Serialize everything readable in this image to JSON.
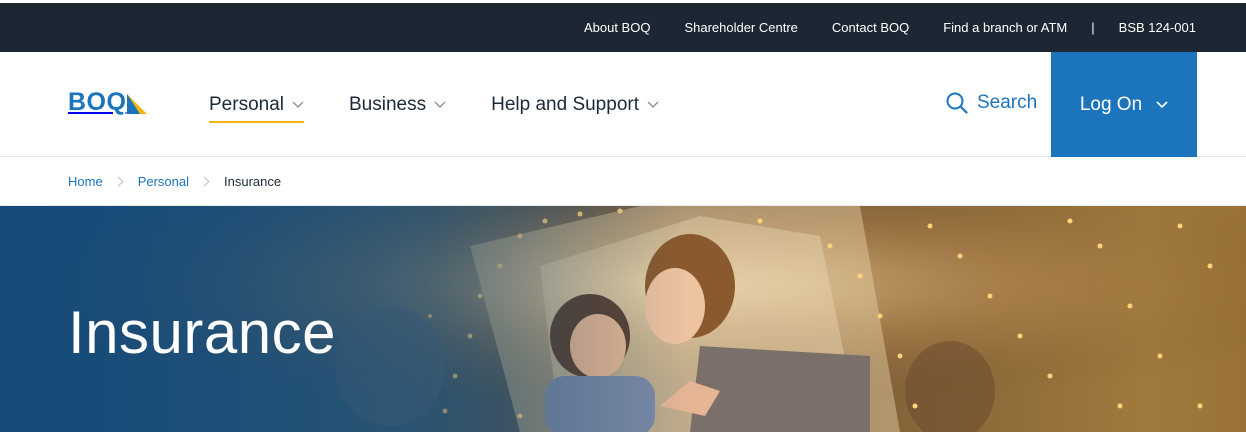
{
  "utility_nav": {
    "links": [
      "About BOQ",
      "Shareholder Centre",
      "Contact BOQ",
      "Find a branch or ATM"
    ],
    "separator": "|",
    "bsb": "BSB 124-001"
  },
  "header": {
    "logo_text": "BOQ",
    "nav": [
      {
        "label": "Personal",
        "active": true
      },
      {
        "label": "Business",
        "active": false
      },
      {
        "label": "Help and Support",
        "active": false
      }
    ],
    "search_label": "Search",
    "logon_label": "Log On"
  },
  "breadcrumb": {
    "items": [
      "Home",
      "Personal",
      "Insurance"
    ]
  },
  "hero": {
    "title": "Insurance"
  },
  "colors": {
    "brand_blue": "#1c75bc",
    "topbar_bg": "#1d2733",
    "active_underline": "#f2b514"
  }
}
